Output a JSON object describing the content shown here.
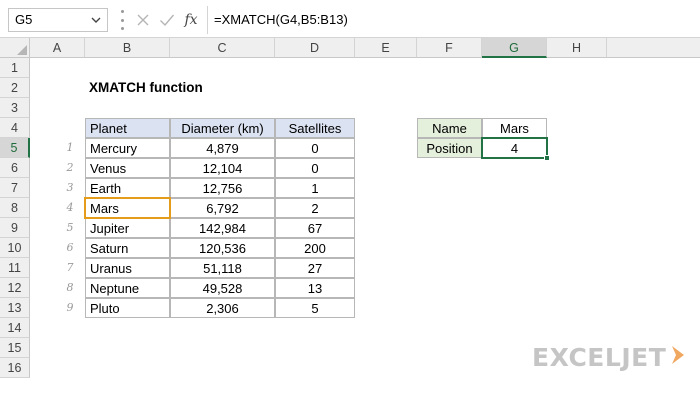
{
  "name_box": {
    "value": "G5"
  },
  "formula_bar": {
    "fx_label": "fx",
    "formula": "=XMATCH(G4,B5:B13)"
  },
  "columns": [
    "A",
    "B",
    "C",
    "D",
    "E",
    "F",
    "G",
    "H"
  ],
  "rows": [
    "1",
    "2",
    "3",
    "4",
    "5",
    "6",
    "7",
    "8",
    "9",
    "10",
    "11",
    "12",
    "13",
    "14",
    "15",
    "16"
  ],
  "active_cell": {
    "column": "G",
    "row": "5"
  },
  "sheet": {
    "title": "XMATCH function",
    "table_headers": [
      "Planet",
      "Diameter (km)",
      "Satellites"
    ],
    "table_rows": [
      {
        "index": "1",
        "planet": "Mercury",
        "diameter": "4,879",
        "satellites": "0"
      },
      {
        "index": "2",
        "planet": "Venus",
        "diameter": "12,104",
        "satellites": "0"
      },
      {
        "index": "3",
        "planet": "Earth",
        "diameter": "12,756",
        "satellites": "1"
      },
      {
        "index": "4",
        "planet": "Mars",
        "diameter": "6,792",
        "satellites": "2"
      },
      {
        "index": "5",
        "planet": "Jupiter",
        "diameter": "142,984",
        "satellites": "67"
      },
      {
        "index": "6",
        "planet": "Saturn",
        "diameter": "120,536",
        "satellites": "200"
      },
      {
        "index": "7",
        "planet": "Uranus",
        "diameter": "51,118",
        "satellites": "27"
      },
      {
        "index": "8",
        "planet": "Neptune",
        "diameter": "49,528",
        "satellites": "13"
      },
      {
        "index": "9",
        "planet": "Pluto",
        "diameter": "2,306",
        "satellites": "5"
      }
    ],
    "lookup": {
      "name_label": "Name",
      "name_value": "Mars",
      "position_label": "Position",
      "position_value": "4"
    },
    "highlighted_row_index": 3
  },
  "logo": {
    "text": "EXCELJET"
  },
  "colors": {
    "header_fill": "#dbe2f1",
    "lookup_fill": "#e4efdc",
    "orange_highlight": "#e59c1b",
    "selection_green": "#217346"
  }
}
